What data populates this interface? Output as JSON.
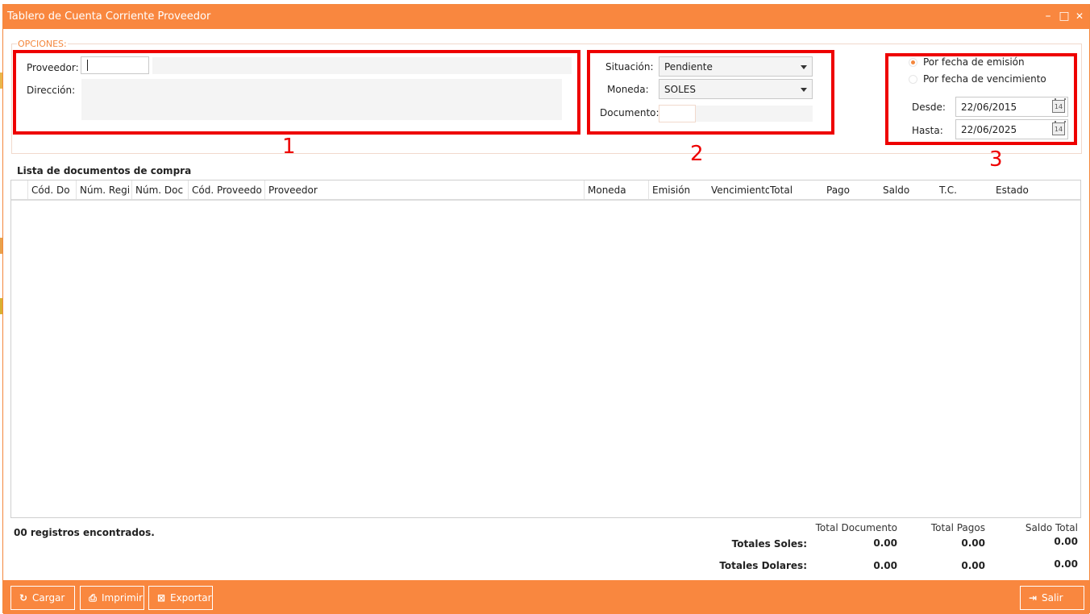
{
  "window": {
    "title": "Tablero de Cuenta Corriente Proveedor",
    "controls": {
      "minimize": "–",
      "maximize": "□",
      "close": "✕"
    }
  },
  "options": {
    "legend": "OPCIONES:",
    "box1": {
      "proveedor_label": "Proveedor:",
      "proveedor_value": "",
      "direccion_label": "Dirección:",
      "number": "1"
    },
    "box2": {
      "situacion_label": "Situación:",
      "situacion_value": "Pendiente",
      "moneda_label": "Moneda:",
      "moneda_value": "SOLES",
      "documento_label": "Documento:",
      "number": "2"
    },
    "box3": {
      "radio1": "Por fecha de emisión",
      "radio2": "Por fecha de vencimiento",
      "desde_label": "Desde:",
      "desde_value": "22/06/2015",
      "hasta_label": "Hasta:",
      "hasta_value": "22/06/2025",
      "calendar_icon_text": "14",
      "number": "3"
    }
  },
  "list": {
    "title": "Lista de documentos de compra",
    "columns": [
      "Cód. Do",
      "Núm. Regi",
      "Núm. Doc",
      "Cód. Proveedo",
      "Proveedor",
      "Moneda",
      "Emisión",
      "Vencimiento",
      "Total",
      "Pago",
      "Saldo",
      "T.C.",
      "Estado"
    ]
  },
  "summary": {
    "records": "00 registros encontrados.",
    "headers": {
      "total_documento": "Total Documento",
      "total_pagos": "Total Pagos",
      "saldo_total": "Saldo Total"
    },
    "soles": {
      "label": "Totales Soles:",
      "documento": "0.00",
      "pagos": "0.00",
      "saldo": "0.00"
    },
    "dolares": {
      "label": "Totales Dolares:",
      "documento": "0.00",
      "pagos": "0.00",
      "saldo": "0.00"
    }
  },
  "footer": {
    "cargar": "Cargar",
    "imprimir": "Imprimir",
    "exportar": "Exportar",
    "salir": "Salir"
  },
  "colors": {
    "accent": "#f9873f",
    "highlight": "#ee0000"
  }
}
